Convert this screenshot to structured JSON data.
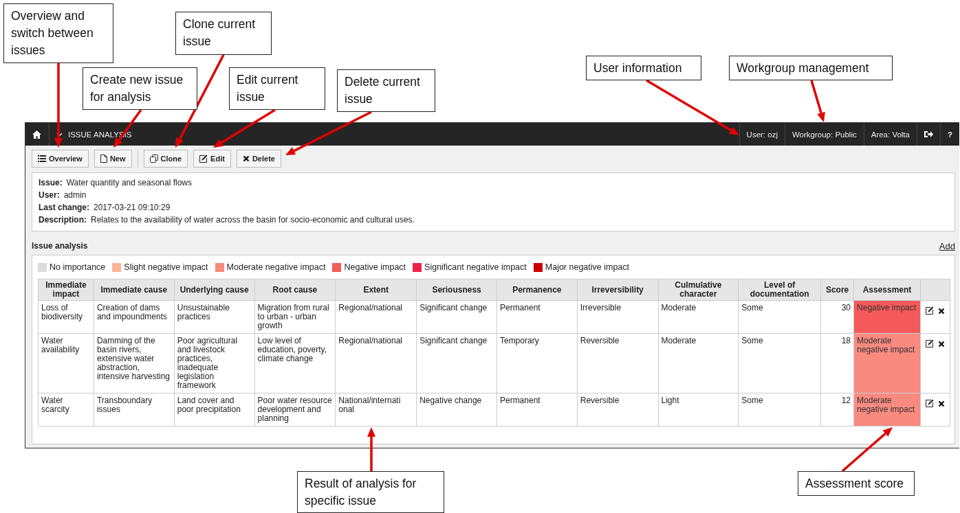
{
  "callouts": [
    {
      "text": "Overview and switch between issues"
    },
    {
      "text": "Create new issue for analysis"
    },
    {
      "text": "Clone current issue"
    },
    {
      "text": "Edit current issue"
    },
    {
      "text": "Delete current issue"
    },
    {
      "text": "User information"
    },
    {
      "text": "Workgroup management"
    },
    {
      "text": "Result of analysis for specific issue"
    },
    {
      "text": "Assessment score"
    }
  ],
  "navbar": {
    "title": "ISSUE ANALYSIS",
    "user": "User: ozj",
    "workgroup": "Workgroup: Public",
    "area": "Area: Volta",
    "help": "?"
  },
  "toolbar": [
    [
      {
        "label": "Overview"
      },
      {
        "label": "New"
      }
    ],
    [
      {
        "label": "Clone"
      },
      {
        "label": "Edit"
      },
      {
        "label": "Delete"
      }
    ]
  ],
  "info": [
    {
      "label": "Issue:",
      "value": "Water quantity and seasonal flows"
    },
    {
      "label": "User:",
      "value": "admin"
    },
    {
      "label": "Last change:",
      "value": "2017-03-21 09:10:29"
    },
    {
      "label": "Description:",
      "value": "Relates to the availability of water across the basin for socio-economic and cultural uses."
    }
  ],
  "section": {
    "title": "Issue analysis",
    "add": "Add"
  },
  "legend": [
    {
      "label": "No importance",
      "color": "#dcdcdc"
    },
    {
      "label": "Slight negative impact",
      "color": "#f9b49a"
    },
    {
      "label": "Moderate negative impact",
      "color": "#f98b7e"
    },
    {
      "label": "Negative impact",
      "color": "#f25c54"
    },
    {
      "label": "Significant negative impact",
      "color": "#ee1f48"
    },
    {
      "label": "Major negative impact",
      "color": "#cc0000"
    }
  ],
  "table": {
    "columns": [
      "Immediate impact",
      "Immediate cause",
      "Underlying cause",
      "Root cause",
      "Extent",
      "Seriousness",
      "Permanence",
      "Irreversibility",
      "Culmulative character",
      "Level of documentation",
      "Score",
      "Assessment"
    ],
    "rows": [
      {
        "cells": [
          "Loss of biodiversity",
          "Creation of dams and impoundments",
          "Unsustainable practices",
          "Migration from rural to urban - urban growth",
          "Regional/national",
          "Significant change",
          "Permanent",
          "Irreversible",
          "Moderate",
          "Some"
        ],
        "score": "30",
        "assessment": "Negative impact",
        "color": "#f55a5a"
      },
      {
        "cells": [
          "Water availability",
          "Damming of the basin rivers, extensive water abstraction, intensive harvesting",
          "Poor agricultural and livestock practices, inadequate legislation framework",
          "Low level of education, poverty, climate change",
          "Regional/national",
          "Significant change",
          "Temporary",
          "Reversible",
          "Moderate",
          "Some"
        ],
        "score": "18",
        "assessment": "Moderate negative impact",
        "color": "#f98a80"
      },
      {
        "cells": [
          "Water scarcity",
          "Transboundary issues",
          "Land cover and poor precipitation",
          "Poor water resource development and planning",
          "National/internati onal",
          "Negative change",
          "Permanent",
          "Reversible",
          "Light",
          "Some"
        ],
        "score": "12",
        "assessment": "Moderate negative impact",
        "color": "#f98a80"
      }
    ]
  }
}
